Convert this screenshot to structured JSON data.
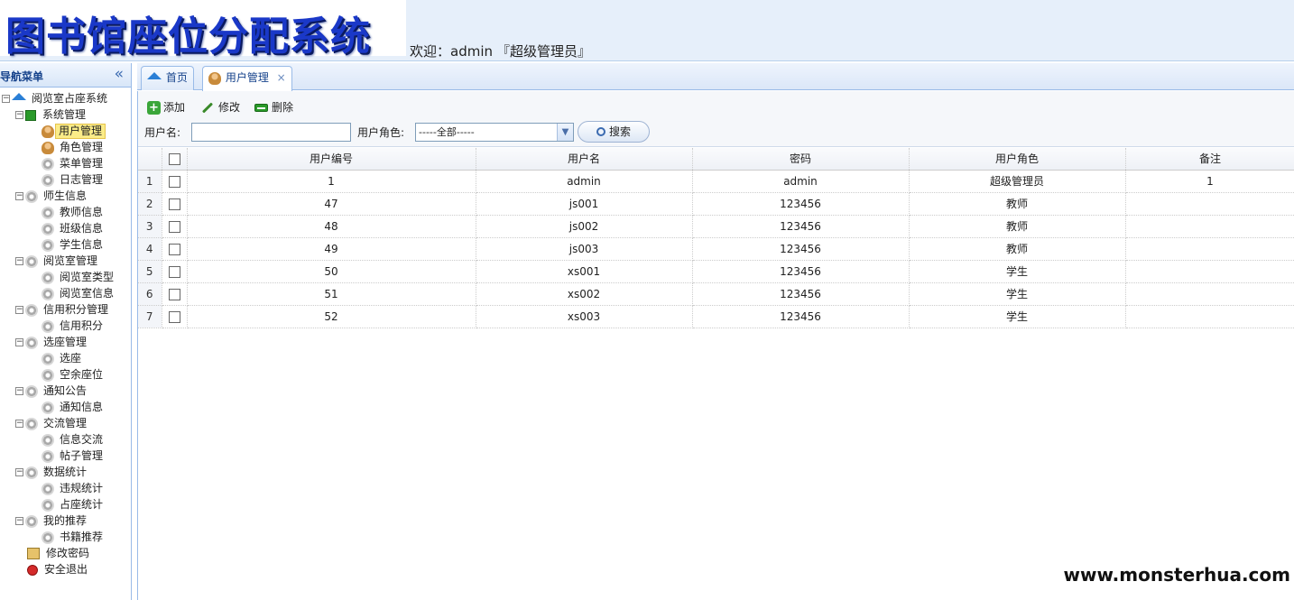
{
  "header": {
    "system_title": "图书馆座位分配系统",
    "welcome_prefix": "欢迎：",
    "username": "admin",
    "role": "『超级管理员』"
  },
  "sidebar": {
    "title": "导航菜单",
    "collapse_glyph": "«",
    "tree": [
      {
        "label": "阅览室占座系统",
        "level": 0,
        "icon": "home-icon",
        "toggle": "−"
      },
      {
        "label": "系统管理",
        "level": 1,
        "icon": "green-book-icon",
        "toggle": "−"
      },
      {
        "label": "用户管理",
        "level": 2,
        "icon": "user-icon",
        "selected": true
      },
      {
        "label": "角色管理",
        "level": 2,
        "icon": "user-icon"
      },
      {
        "label": "菜单管理",
        "level": 2,
        "icon": "gear-icon"
      },
      {
        "label": "日志管理",
        "level": 2,
        "icon": "gear-icon"
      },
      {
        "label": "师生信息",
        "level": 1,
        "icon": "gear-icon",
        "toggle": "−"
      },
      {
        "label": "教师信息",
        "level": 2,
        "icon": "gear-icon"
      },
      {
        "label": "班级信息",
        "level": 2,
        "icon": "gear-icon"
      },
      {
        "label": "学生信息",
        "level": 2,
        "icon": "gear-icon"
      },
      {
        "label": "阅览室管理",
        "level": 1,
        "icon": "gear-icon",
        "toggle": "−"
      },
      {
        "label": "阅览室类型",
        "level": 2,
        "icon": "gear-icon"
      },
      {
        "label": "阅览室信息",
        "level": 2,
        "icon": "gear-icon"
      },
      {
        "label": "信用积分管理",
        "level": 1,
        "icon": "gear-icon",
        "toggle": "−"
      },
      {
        "label": "信用积分",
        "level": 2,
        "icon": "gear-icon"
      },
      {
        "label": "选座管理",
        "level": 1,
        "icon": "gear-icon",
        "toggle": "−"
      },
      {
        "label": "选座",
        "level": 2,
        "icon": "gear-icon"
      },
      {
        "label": "空余座位",
        "level": 2,
        "icon": "gear-icon"
      },
      {
        "label": "通知公告",
        "level": 1,
        "icon": "gear-icon",
        "toggle": "−"
      },
      {
        "label": "通知信息",
        "level": 2,
        "icon": "gear-icon"
      },
      {
        "label": "交流管理",
        "level": 1,
        "icon": "gear-icon",
        "toggle": "−"
      },
      {
        "label": "信息交流",
        "level": 2,
        "icon": "gear-icon"
      },
      {
        "label": "帖子管理",
        "level": 2,
        "icon": "gear-icon"
      },
      {
        "label": "数据统计",
        "level": 1,
        "icon": "gear-icon",
        "toggle": "−"
      },
      {
        "label": "违规统计",
        "level": 2,
        "icon": "gear-icon"
      },
      {
        "label": "占座统计",
        "level": 2,
        "icon": "gear-icon"
      },
      {
        "label": "我的推荐",
        "level": 1,
        "icon": "gear-icon",
        "toggle": "−"
      },
      {
        "label": "书籍推荐",
        "level": 2,
        "icon": "gear-icon"
      },
      {
        "label": "修改密码",
        "level": 1,
        "icon": "key-icon"
      },
      {
        "label": "安全退出",
        "level": 1,
        "icon": "exit-icon"
      }
    ]
  },
  "tabs": [
    {
      "label": "首页",
      "icon": "home-icon",
      "active": false
    },
    {
      "label": "用户管理",
      "icon": "user-icon",
      "active": true,
      "closable": true
    }
  ],
  "toolbar": {
    "add_label": "添加",
    "edit_label": "修改",
    "delete_label": "删除",
    "username_label": "用户名:",
    "username_value": "",
    "role_label": "用户角色:",
    "role_selected": "-----全部-----",
    "search_label": "搜索"
  },
  "grid": {
    "columns": [
      "用户编号",
      "用户名",
      "密码",
      "用户角色",
      "备注"
    ],
    "rows": [
      {
        "num": "1",
        "id": "1",
        "username": "admin",
        "password": "admin",
        "role": "超级管理员",
        "remark": "1"
      },
      {
        "num": "2",
        "id": "47",
        "username": "js001",
        "password": "123456",
        "role": "教师",
        "remark": ""
      },
      {
        "num": "3",
        "id": "48",
        "username": "js002",
        "password": "123456",
        "role": "教师",
        "remark": ""
      },
      {
        "num": "4",
        "id": "49",
        "username": "js003",
        "password": "123456",
        "role": "教师",
        "remark": ""
      },
      {
        "num": "5",
        "id": "50",
        "username": "xs001",
        "password": "123456",
        "role": "学生",
        "remark": ""
      },
      {
        "num": "6",
        "id": "51",
        "username": "xs002",
        "password": "123456",
        "role": "学生",
        "remark": ""
      },
      {
        "num": "7",
        "id": "52",
        "username": "xs003",
        "password": "123456",
        "role": "学生",
        "remark": ""
      }
    ]
  },
  "watermark": "www.monsterhua.com"
}
